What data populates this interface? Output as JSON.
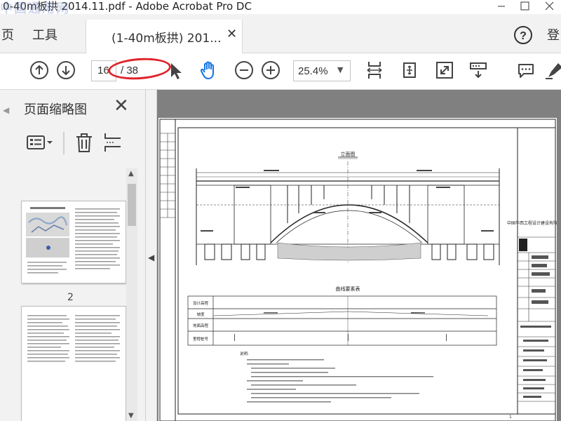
{
  "window": {
    "title": "0-40m板拱 2014.11.pdf - Adobe Acrobat Pro DC",
    "watermark": "中国通用网"
  },
  "menubar": {
    "home_partial": "页",
    "tools": "工具",
    "doc_tab": "(1-40m板拱) 201...",
    "sign_in_partial": "登"
  },
  "toolbar": {
    "page_current": "16",
    "page_total": "/ 38",
    "zoom": "25.4%"
  },
  "panel": {
    "title": "页面缩略图",
    "page_label": "2"
  },
  "drawing": {
    "elevation_title": "立面图",
    "curve_table_title": "曲线要素表",
    "table_rows": [
      "设计高程",
      "坡度",
      "地面高程",
      "里程桩号"
    ],
    "notes_heading": "说明:",
    "company": "中国华西工程设计建设有限公司",
    "page_footer": "1"
  }
}
